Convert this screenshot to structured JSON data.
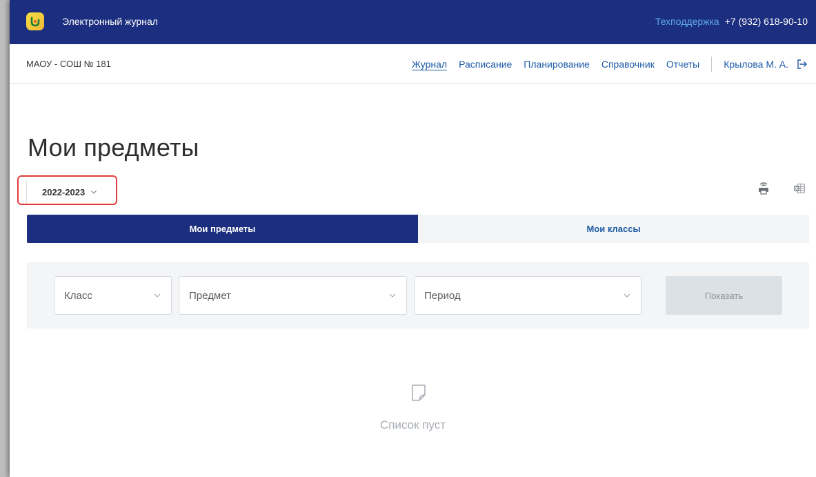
{
  "header": {
    "app_title": "Электронный журнал",
    "support_label": "Техподдержка",
    "phone": "+7 (932) 618-90-10",
    "brand_color": "#1c2e7f",
    "link_color": "#5fa9ee"
  },
  "navbar": {
    "school": "МАОУ - СОШ № 181",
    "links": [
      {
        "label": "Журнал",
        "active": true
      },
      {
        "label": "Расписание"
      },
      {
        "label": "Планирование"
      },
      {
        "label": "Справочник"
      },
      {
        "label": "Отчеты"
      }
    ],
    "user": "Крылова М. А.",
    "logout_icon": "logout-icon"
  },
  "main": {
    "title": "Мои предметы",
    "year_select": {
      "value": "2022-2023",
      "highlight_color": "#e23d3d"
    },
    "tools": [
      {
        "icon": "print-icon"
      },
      {
        "icon": "excel-icon"
      }
    ],
    "tabs": [
      {
        "label": "Мои предметы",
        "active": true
      },
      {
        "label": "Мои классы",
        "active": false
      }
    ],
    "filters": {
      "class_placeholder": "Класс",
      "subject_placeholder": "Предмет",
      "period_placeholder": "Период",
      "show_label": "Показать"
    },
    "empty": {
      "text": "Список пуст",
      "icon": "empty-note-icon"
    }
  }
}
